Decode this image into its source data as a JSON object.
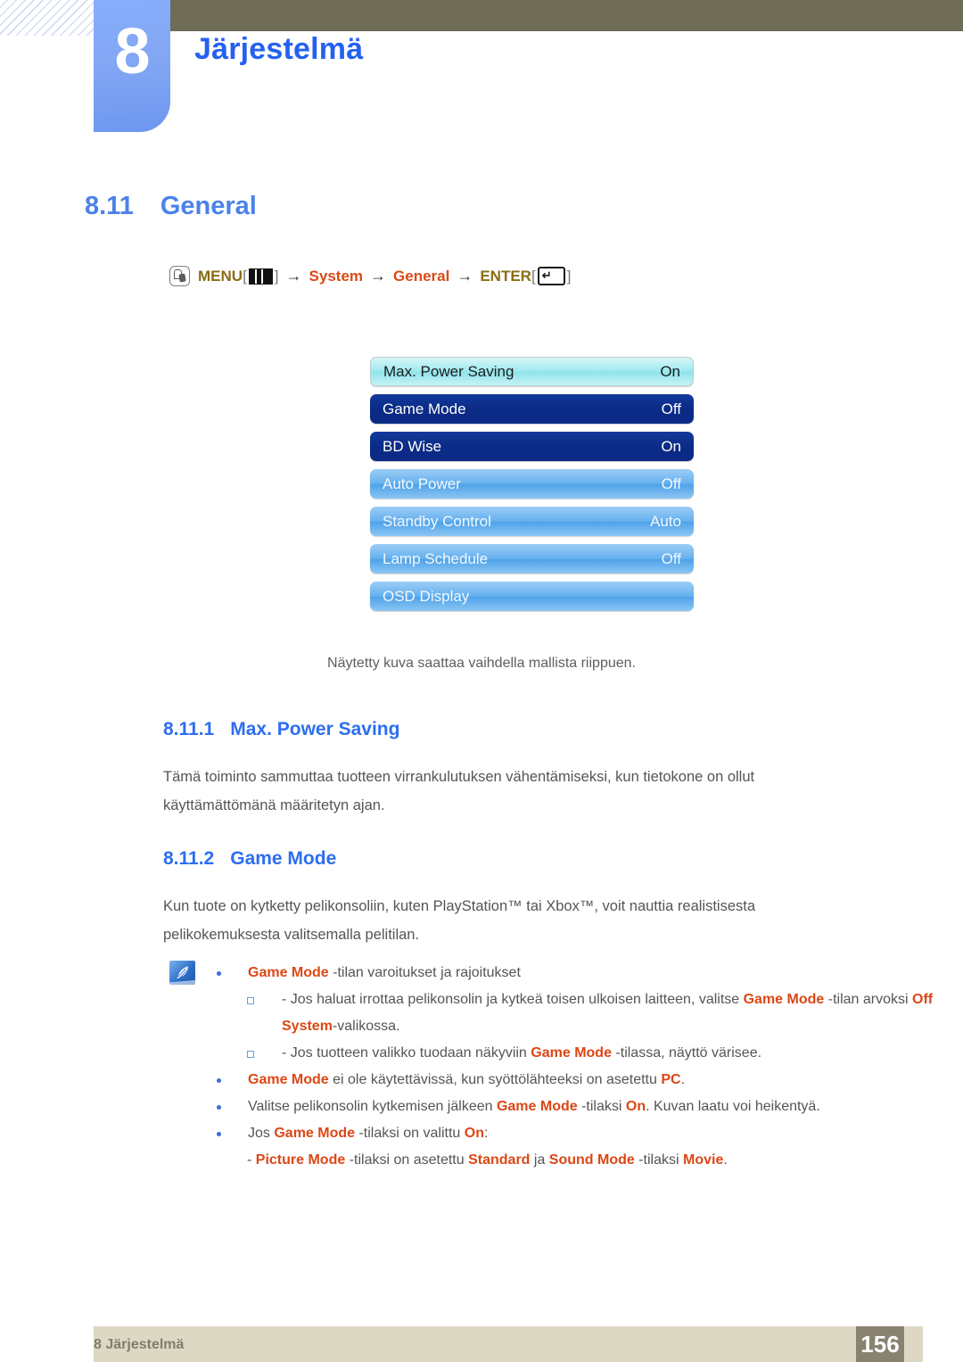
{
  "header": {
    "chapter_number": "8",
    "chapter_title": "Järjestelmä"
  },
  "section": {
    "number": "8.11",
    "title": "General"
  },
  "menu_path": {
    "mouse_icon": "mouse-click-icon",
    "menu_label": "MENU",
    "menu_glyph": "menu-bars-icon",
    "bracket_open": "[",
    "bracket_close": "]",
    "arrow": "→",
    "system_label": "System",
    "general_label": "General",
    "enter_label": "ENTER",
    "enter_glyph": "enter-key-icon",
    "enter_arrow": "↵"
  },
  "osd": {
    "rows": [
      {
        "label": "Max. Power Saving",
        "value": "On",
        "style": "selected"
      },
      {
        "label": "Game Mode",
        "value": "Off",
        "style": "dark"
      },
      {
        "label": "BD Wise",
        "value": "On",
        "style": "dark"
      },
      {
        "label": "Auto Power",
        "value": "Off",
        "style": "light"
      },
      {
        "label": "Standby Control",
        "value": "Auto",
        "style": "light"
      },
      {
        "label": "Lamp Schedule",
        "value": "Off",
        "style": "light"
      },
      {
        "label": "OSD Display",
        "value": "",
        "style": "light"
      }
    ],
    "caption": "Näytetty kuva saattaa vaihdella mallista riippuen."
  },
  "subsections": [
    {
      "number": "8.11.1",
      "title": "Max. Power Saving",
      "body": "Tämä toiminto sammuttaa tuotteen virrankulutuksen vähentämiseksi, kun tietokone on ollut käyttämättömänä määritetyn ajan."
    },
    {
      "number": "8.11.2",
      "title": "Game Mode",
      "body": "Kun tuote on kytketty pelikonsoliin, kuten PlayStation™ tai Xbox™, voit nauttia realistisesta pelikokemuksesta valitsemalla pelitilan."
    }
  ],
  "note": {
    "icon": "note-quill-icon",
    "lines": [
      {
        "level": 1,
        "parts": [
          {
            "t": "Game Mode",
            "kw": true
          },
          {
            "t": " -tilan varoitukset ja rajoitukset",
            "kw": false
          }
        ]
      },
      {
        "level": 2,
        "parts": [
          {
            "t": "- Jos haluat irrottaa pelikonsolin ja kytkeä toisen ulkoisen laitteen, valitse ",
            "kw": false
          },
          {
            "t": "Game Mode",
            "kw": true
          },
          {
            "t": " -tilan arvoksi ",
            "kw": false
          },
          {
            "t": "Off System",
            "kw": true
          },
          {
            "t": "-valikossa.",
            "kw": false
          }
        ]
      },
      {
        "level": 2,
        "parts": [
          {
            "t": "- Jos tuotteen valikko tuodaan näkyviin ",
            "kw": false
          },
          {
            "t": "Game Mode",
            "kw": true
          },
          {
            "t": " -tilassa, näyttö värisee.",
            "kw": false
          }
        ]
      },
      {
        "level": 1,
        "parts": [
          {
            "t": "Game Mode",
            "kw": true
          },
          {
            "t": " ei ole käytettävissä, kun syöttölähteeksi on asetettu ",
            "kw": false
          },
          {
            "t": "PC",
            "kw": true
          },
          {
            "t": ".",
            "kw": false
          }
        ]
      },
      {
        "level": 1,
        "parts": [
          {
            "t": "Valitse pelikonsolin kytkemisen jälkeen ",
            "kw": false
          },
          {
            "t": "Game Mode",
            "kw": true
          },
          {
            "t": " -tilaksi ",
            "kw": false
          },
          {
            "t": "On",
            "kw": true
          },
          {
            "t": ". Kuvan laatu voi heikentyä.",
            "kw": false
          }
        ]
      },
      {
        "level": 1,
        "parts": [
          {
            "t": "Jos ",
            "kw": false
          },
          {
            "t": "Game Mode",
            "kw": true
          },
          {
            "t": " -tilaksi on valittu ",
            "kw": false
          },
          {
            "t": "On",
            "kw": true
          },
          {
            "t": ":",
            "kw": false
          }
        ]
      },
      {
        "level": 0,
        "parts": [
          {
            "t": "- ",
            "kw": false
          },
          {
            "t": "Picture Mode",
            "kw": true
          },
          {
            "t": " -tilaksi on asetettu ",
            "kw": false
          },
          {
            "t": "Standard",
            "kw": true
          },
          {
            "t": " ja ",
            "kw": false
          },
          {
            "t": "Sound Mode",
            "kw": true
          },
          {
            "t": " -tilaksi ",
            "kw": false
          },
          {
            "t": "Movie",
            "kw": true
          },
          {
            "t": ".",
            "kw": false
          }
        ]
      }
    ]
  },
  "footer": {
    "label": "8 Järjestelmä",
    "page_number": "156"
  },
  "colors": {
    "accent_blue": "#2461f2",
    "heading_blue": "#4a82e8",
    "keyword_orange": "#dc4716",
    "gold": "#8a6d14",
    "top_bar": "#6f6c58",
    "footer_bar": "#ddd8c4",
    "footer_page": "#8a8271"
  }
}
